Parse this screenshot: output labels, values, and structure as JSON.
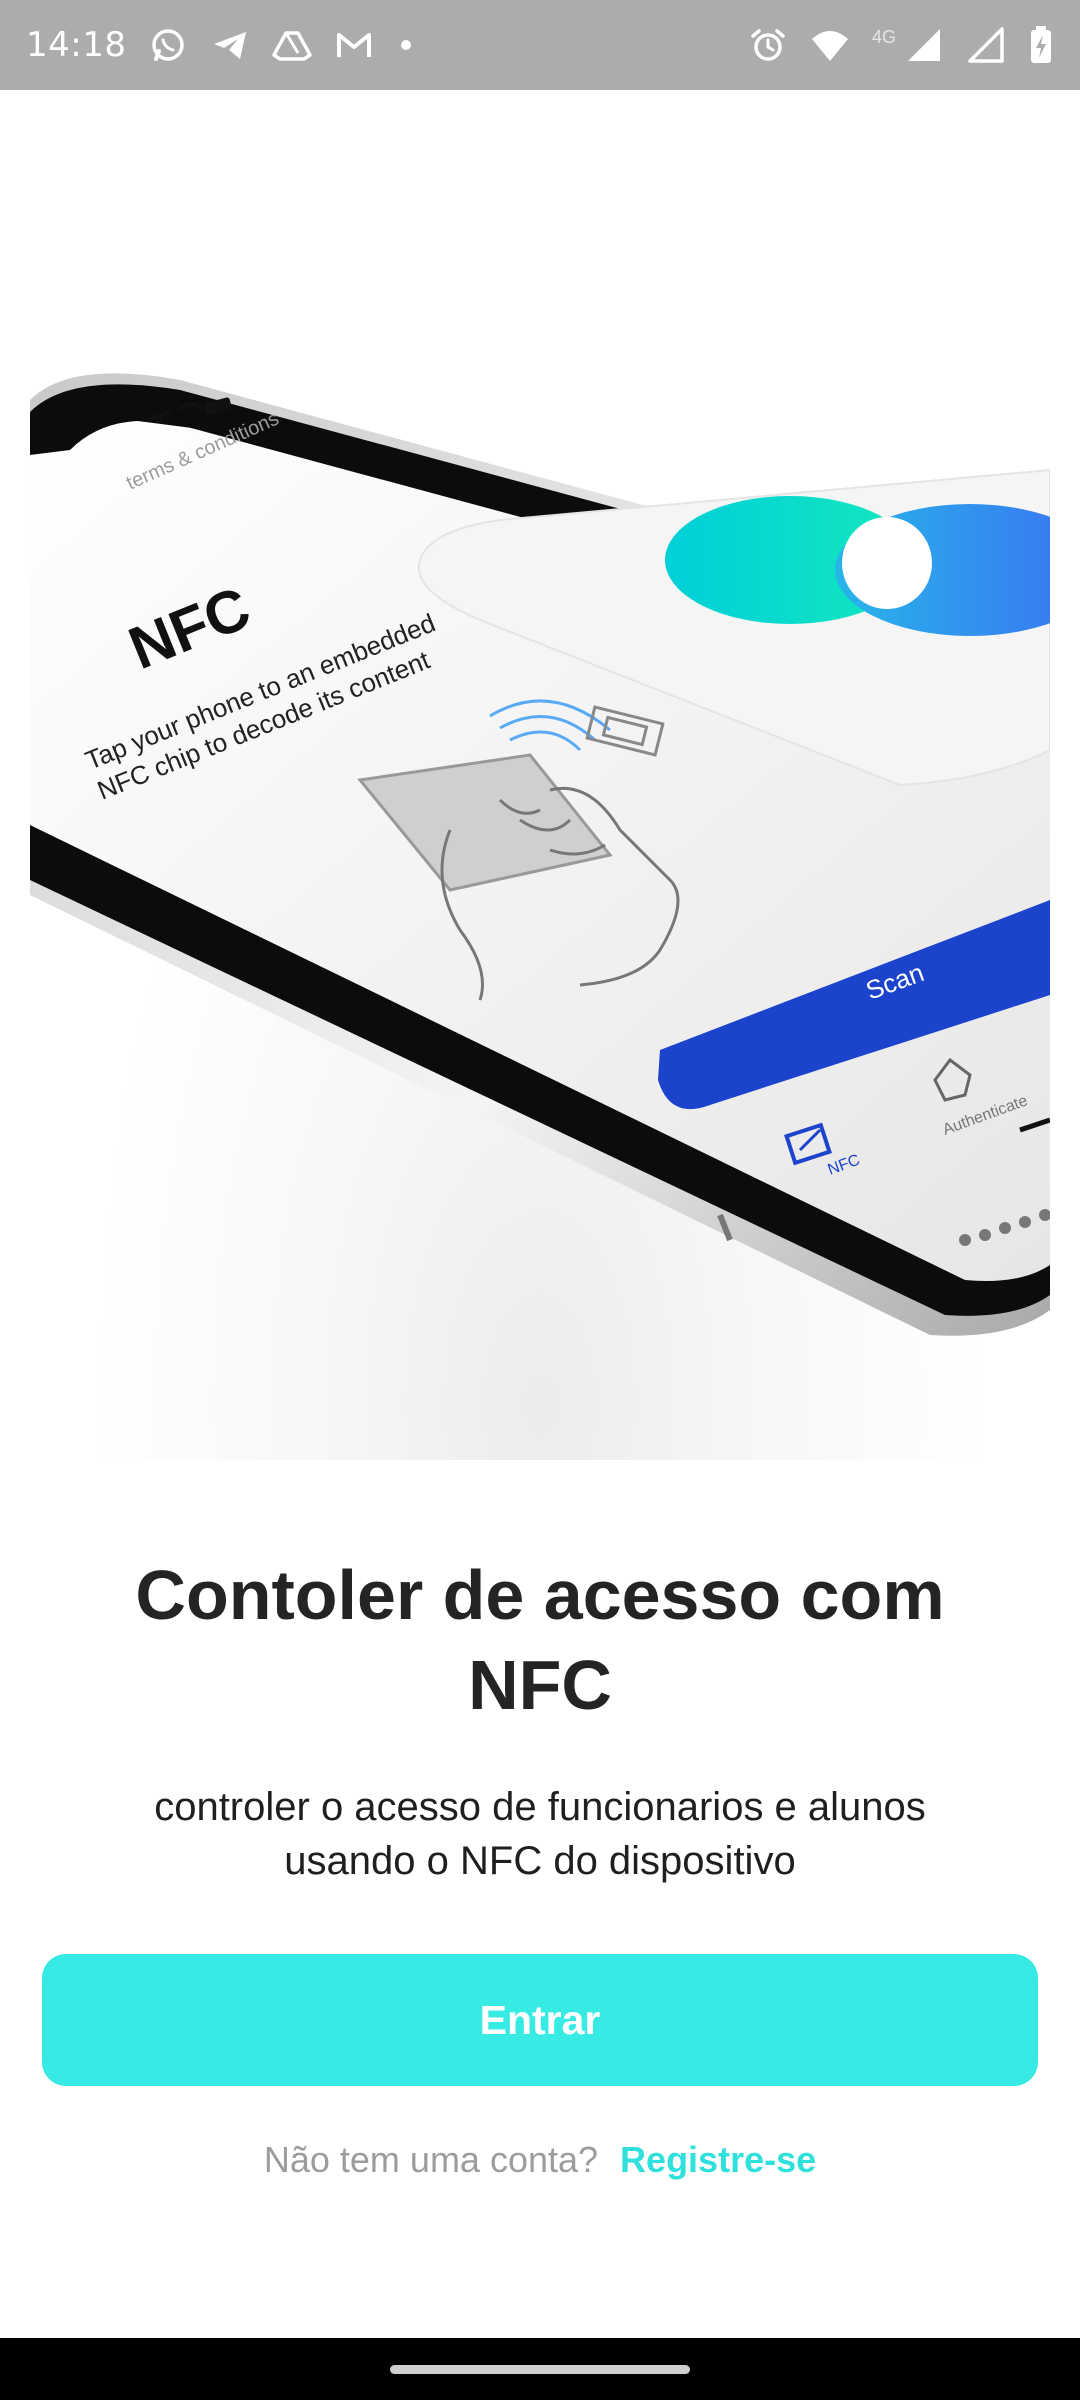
{
  "status_bar": {
    "time": "14:18",
    "network_label": "4G",
    "left_icons": [
      "whatsapp-icon",
      "telegram-icon",
      "drive-icon",
      "gmail-icon",
      "dot-icon"
    ],
    "right_icons": [
      "alarm-icon",
      "wifi-icon",
      "signal-icon",
      "signal-icon",
      "battery-icon"
    ]
  },
  "hero": {
    "phone_screen_title": "NFC",
    "phone_screen_subtitle_line1": "Tap your phone to an embedded",
    "phone_screen_subtitle_line2": "NFC chip to decode its content",
    "phone_screen_top_link": "terms & conditions",
    "scan_button_label": "Scan",
    "tab_nfc_label": "NFC",
    "tab_authenticate_label": "Authenticate",
    "colors": {
      "teal": "#1fe0c8",
      "blue": "#2f7ef0",
      "scan": "#1c43cc"
    }
  },
  "main": {
    "headline_line1": "Contoler de acesso com",
    "headline_line2": "NFC",
    "subtitle_line1": "controler o acesso de funcionarios e alunos",
    "subtitle_line2": "usando o NFC do dispositivo",
    "primary_button_label": "Entrar",
    "register_prompt": "Não tem uma conta?",
    "register_link": "Registre-se"
  },
  "colors": {
    "accent": "#37ebe4",
    "link": "#2fe0dc",
    "status_bar": "#acacac",
    "text_dark": "#242424"
  }
}
